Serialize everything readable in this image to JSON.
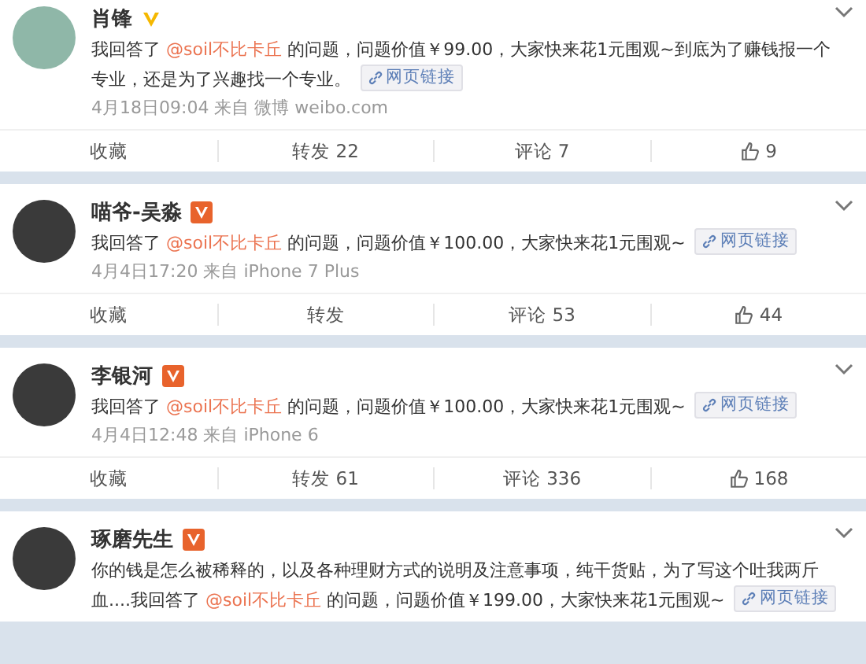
{
  "posts": [
    {
      "name": "肖锋",
      "badge": {
        "kind": "plain",
        "color": "#f5b800"
      },
      "text_before": "我回答了 ",
      "mention": "@soil不比卡丘",
      "text_after": " 的问题，问题价值￥99.00，大家快来花1元围观~到底为了赚钱报一个专业，还是为了兴趣找一个专业。",
      "link": "网页链接",
      "meta": "4月18日09:04 来自 微博 weibo.com",
      "actions": [
        {
          "kind": "text",
          "label": "收藏"
        },
        {
          "kind": "text",
          "label": "转发 22"
        },
        {
          "kind": "text",
          "label": "评论 7"
        },
        {
          "kind": "like",
          "label": "9"
        }
      ]
    },
    {
      "name": "喵爷-吴淼",
      "badge": {
        "kind": "boxed",
        "color": "#e8632c"
      },
      "text_before": "我回答了 ",
      "mention": "@soil不比卡丘",
      "text_after": " 的问题，问题价值￥100.00，大家快来花1元围观~",
      "link": "网页链接",
      "meta": "4月4日17:20 来自 iPhone 7 Plus",
      "actions": [
        {
          "kind": "text",
          "label": "收藏"
        },
        {
          "kind": "text",
          "label": "转发"
        },
        {
          "kind": "text",
          "label": "评论 53"
        },
        {
          "kind": "like",
          "label": "44"
        }
      ]
    },
    {
      "name": "李银河",
      "badge": {
        "kind": "boxed",
        "color": "#e8632c"
      },
      "text_before": "我回答了 ",
      "mention": "@soil不比卡丘",
      "text_after": " 的问题，问题价值￥100.00，大家快来花1元围观~",
      "link": "网页链接",
      "meta": "4月4日12:48 来自 iPhone 6",
      "actions": [
        {
          "kind": "text",
          "label": "收藏"
        },
        {
          "kind": "text",
          "label": "转发 61"
        },
        {
          "kind": "text",
          "label": "评论 336"
        },
        {
          "kind": "like",
          "label": "168"
        }
      ]
    },
    {
      "name": "琢磨先生",
      "badge": {
        "kind": "boxed",
        "color": "#e8632c"
      },
      "text_before": "你的钱是怎么被稀释的，以及各种理财方式的说明及注意事项，纯干货贴，为了写这个吐我两斤血....我回答了 ",
      "mention": "@soil不比卡丘",
      "text_after": " 的问题，问题价值￥199.00，大家快来花1元围观~",
      "link": "网页链接"
    }
  ]
}
